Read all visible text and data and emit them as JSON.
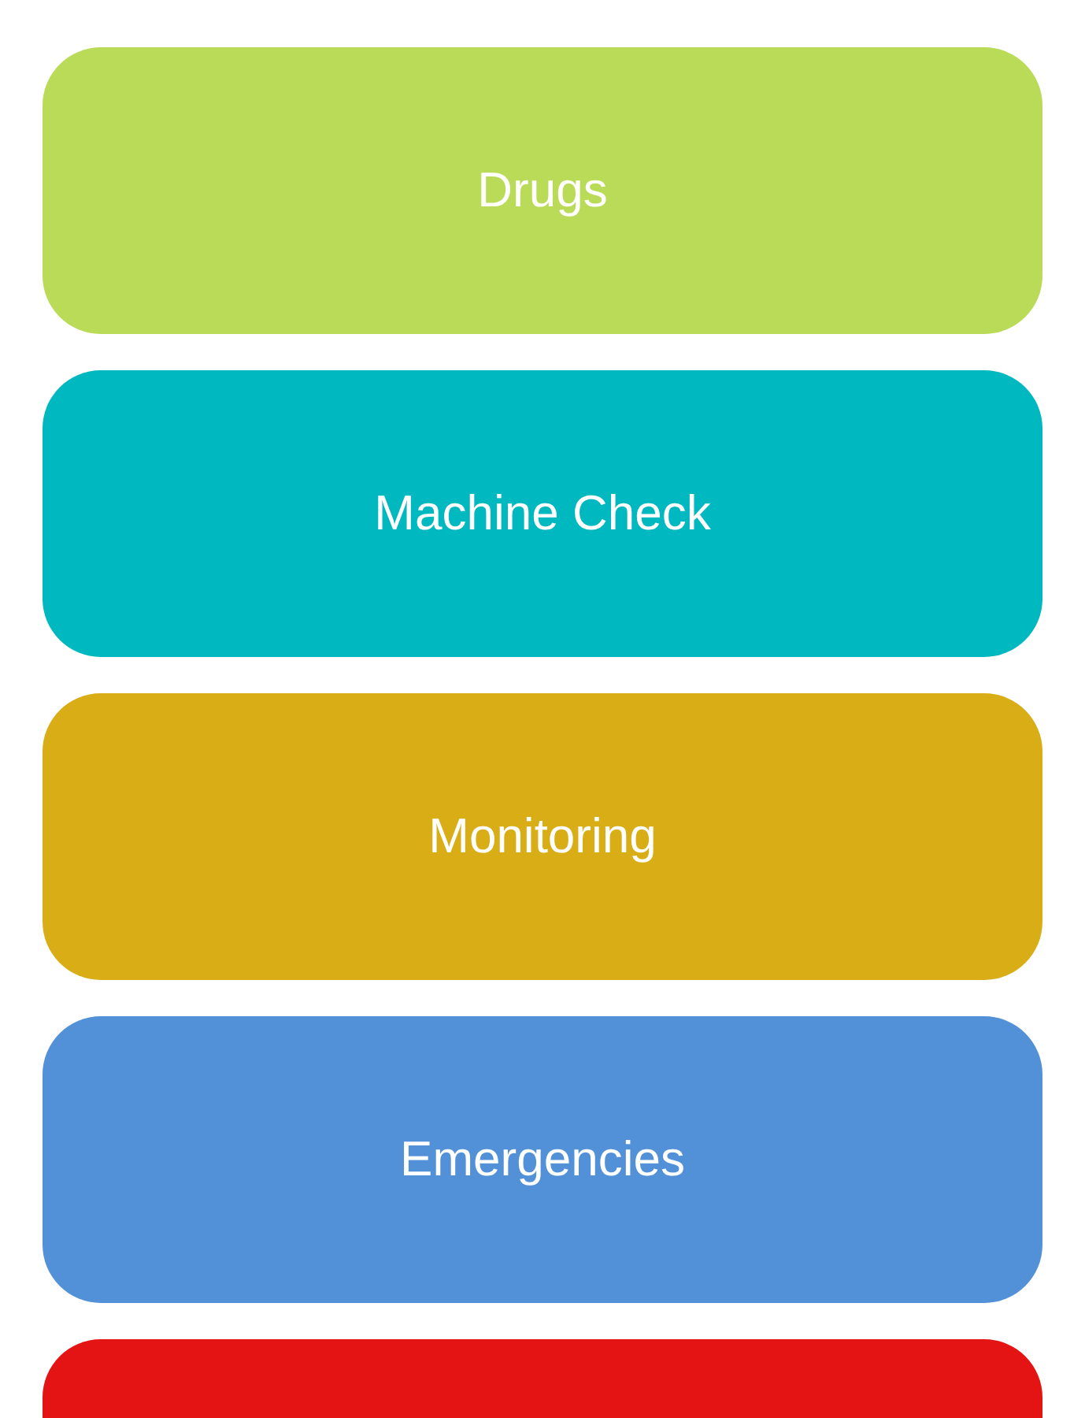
{
  "menu": {
    "items": [
      {
        "label": "Drugs",
        "color": "#badb58"
      },
      {
        "label": "Machine Check",
        "color": "#00b8bf"
      },
      {
        "label": "Monitoring",
        "color": "#d9ad16"
      },
      {
        "label": "Emergencies",
        "color": "#5291d8"
      },
      {
        "color": "#e51414"
      }
    ]
  }
}
